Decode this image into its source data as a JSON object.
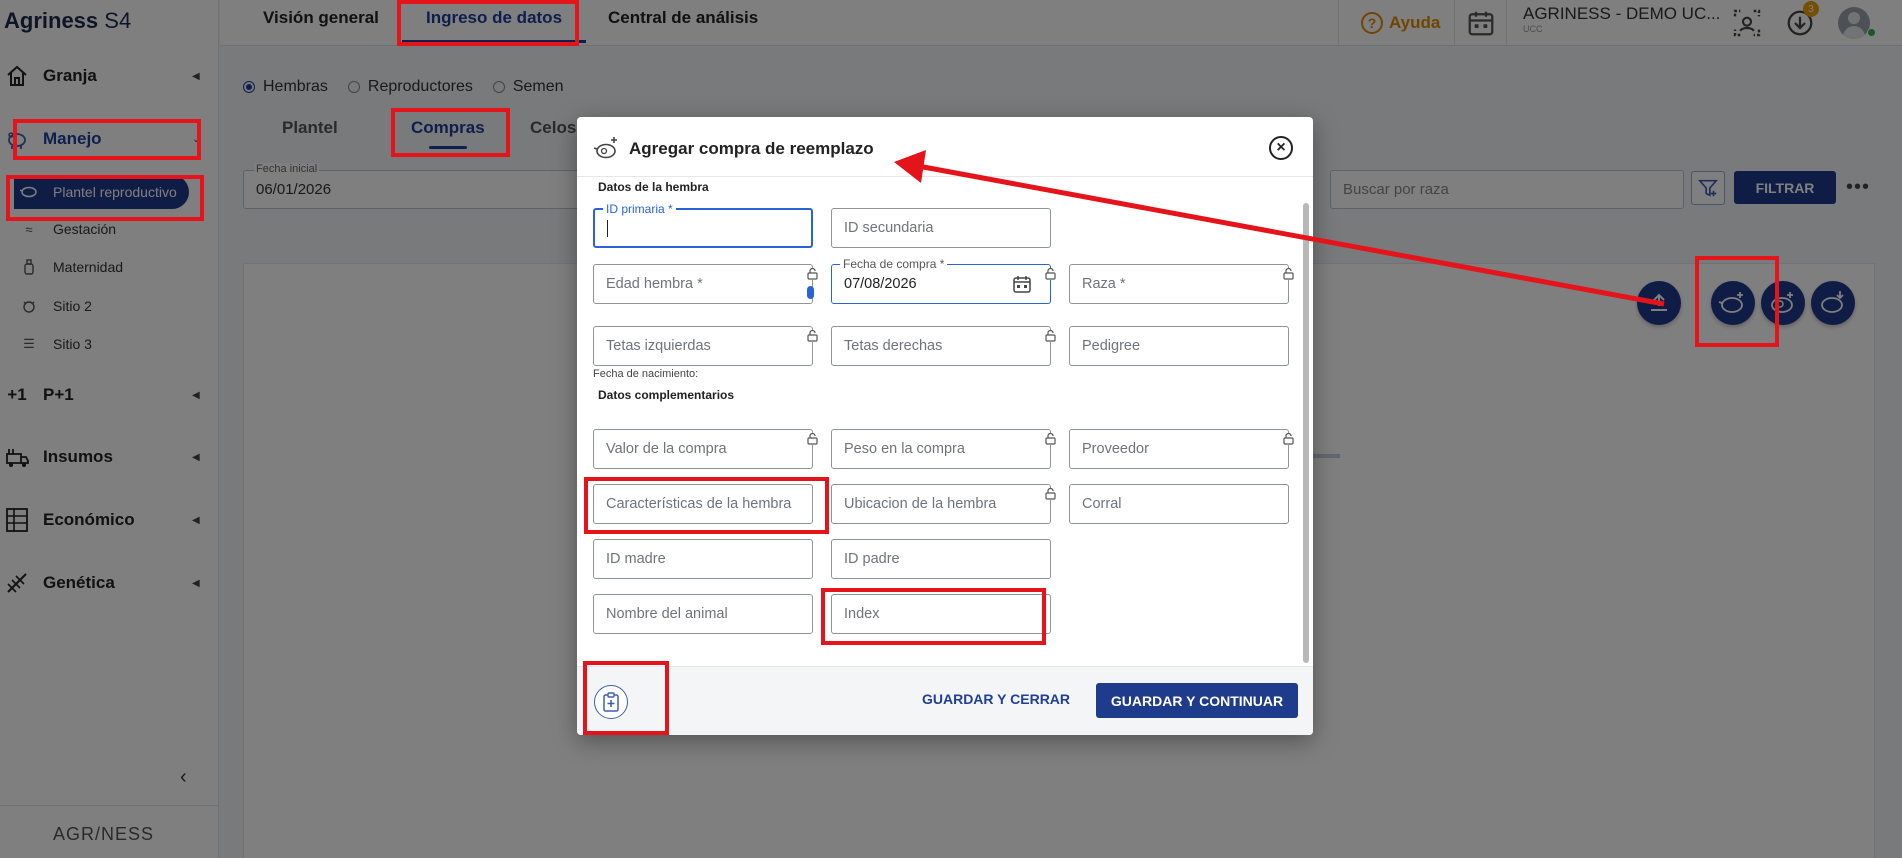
{
  "app": {
    "brand_name": "Agriness",
    "brand_suffix": "S4",
    "footer_logo": "AGR/NESS"
  },
  "sidebar": {
    "sections": [
      {
        "label": "Granja",
        "icon": "home-icon"
      },
      {
        "label": "Manejo",
        "icon": "pig-icon"
      },
      {
        "label": "P+1",
        "icon": "plus-one-icon"
      },
      {
        "label": "Insumos",
        "icon": "truck-icon"
      },
      {
        "label": "Económico",
        "icon": "spreadsheet-icon"
      },
      {
        "label": "Genética",
        "icon": "dna-icon"
      }
    ],
    "manejo_items": [
      {
        "label": "Plantel reproductivo",
        "icon": "sow-icon"
      },
      {
        "label": "Gestación",
        "icon": "gestation-icon"
      },
      {
        "label": "Maternidad",
        "icon": "bottle-icon"
      },
      {
        "label": "Sitio 2",
        "icon": "piglet-icon"
      },
      {
        "label": "Sitio 3",
        "icon": "pen-icon"
      }
    ]
  },
  "topbar": {
    "tabs": [
      {
        "label": "Visión general"
      },
      {
        "label": "Ingreso de datos"
      },
      {
        "label": "Central de análisis"
      }
    ],
    "help_label": "Ayuda",
    "farm_name": "AGRINESS - DEMO UC...",
    "farm_sub": "UCC",
    "notification_count": "3"
  },
  "page": {
    "radios": [
      "Hembras",
      "Reproductores",
      "Semen"
    ],
    "selected_radio": "Hembras",
    "subtabs": [
      "Plantel",
      "Compras",
      "Celos"
    ],
    "active_subtab": "Compras",
    "fecha_inicial_label": "Fecha inicial",
    "fecha_inicial_value": "06/01/2026",
    "raza_search_placeholder": "Buscar por raza",
    "filter_button": "FILTRAR",
    "more": "•••"
  },
  "dialog": {
    "title": "Agregar compra de reemplazo",
    "section_hembra": "Datos de la hembra",
    "section_complementarios": "Datos complementarios",
    "dob_label": "Fecha de nacimiento:",
    "fields": {
      "id_primaria": {
        "label": "ID primaria *",
        "value": ""
      },
      "id_secundaria": {
        "placeholder": "ID secundaria"
      },
      "edad_hembra": {
        "placeholder": "Edad hembra *"
      },
      "fecha_compra": {
        "label": "Fecha de compra *",
        "value": "07/08/2026"
      },
      "raza": {
        "placeholder": "Raza *"
      },
      "tetas_izq": {
        "placeholder": "Tetas izquierdas"
      },
      "tetas_der": {
        "placeholder": "Tetas derechas"
      },
      "pedigree": {
        "placeholder": "Pedigree"
      },
      "valor_compra": {
        "placeholder": "Valor de la compra"
      },
      "peso_compra": {
        "placeholder": "Peso en la compra"
      },
      "proveedor": {
        "placeholder": "Proveedor"
      },
      "caracteristicas": {
        "placeholder": "Características de la hembra"
      },
      "ubicacion": {
        "placeholder": "Ubicacion de la hembra"
      },
      "corral": {
        "placeholder": "Corral"
      },
      "id_madre": {
        "placeholder": "ID madre"
      },
      "id_padre": {
        "placeholder": "ID padre"
      },
      "nombre_animal": {
        "placeholder": "Nombre del animal"
      },
      "index": {
        "placeholder": "Index"
      }
    },
    "btn_save_close": "GUARDAR Y CERRAR",
    "btn_save_continue": "GUARDAR Y CONTINUAR"
  },
  "colors": {
    "primary": "#1f3b8c",
    "accent": "#2a63d8",
    "help": "#e08a00",
    "annotation": "#e4141a"
  }
}
